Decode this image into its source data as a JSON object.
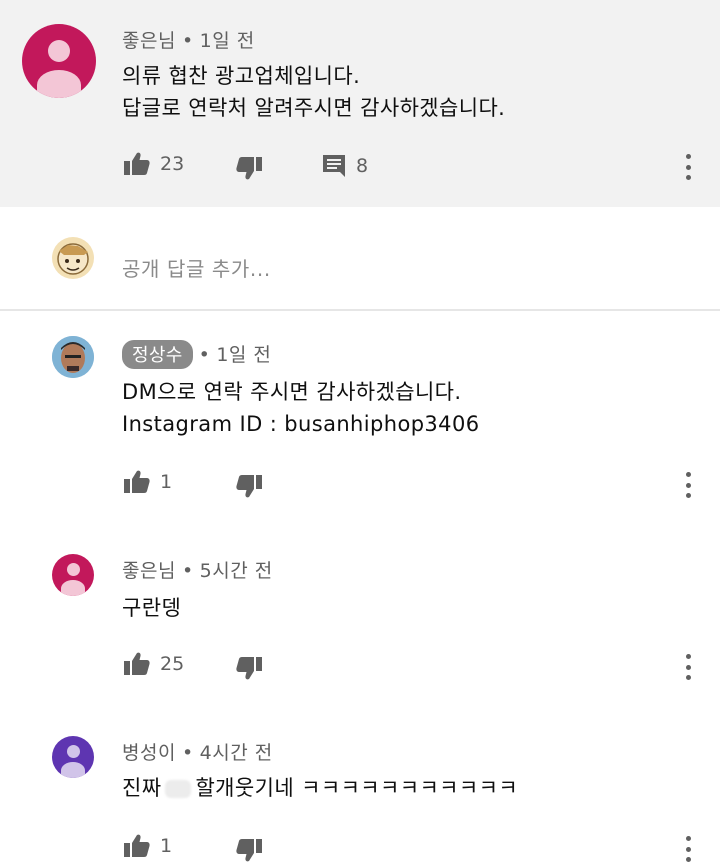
{
  "top_comment": {
    "author": "좋은님",
    "time": "1일 전",
    "lines": [
      "의류 협찬 광고업체입니다.",
      "답글로 연락처 알려주시면 감사하겠습니다."
    ],
    "likes": "23",
    "replies": "8",
    "avatar_color": "#c2185b"
  },
  "add_reply": {
    "placeholder": "공개 답글 추가..."
  },
  "replies": [
    {
      "author": "정상수",
      "time": "1일 전",
      "lines": [
        "DM으로 연락 주시면 감사하겠습니다.",
        "Instagram ID : busanhiphop3406"
      ],
      "likes": "1",
      "highlighted_author": true
    },
    {
      "author": "좋은님",
      "time": "5시간 전",
      "lines": [
        "구란뎅"
      ],
      "likes": "25",
      "avatar_color": "#c2185b"
    },
    {
      "author": "병성이",
      "time": "4시간 전",
      "text_before": "진짜",
      "text_after": "할개웃기네 ㅋㅋㅋㅋㅋㅋㅋㅋㅋㅋㅋ",
      "likes": "1",
      "avatar_color": "#5e35b1"
    }
  ],
  "separator": "•",
  "icons": {
    "like": "thumbs-up-icon",
    "dislike": "thumbs-down-icon",
    "reply": "comment-icon",
    "more": "more-vert-icon"
  }
}
